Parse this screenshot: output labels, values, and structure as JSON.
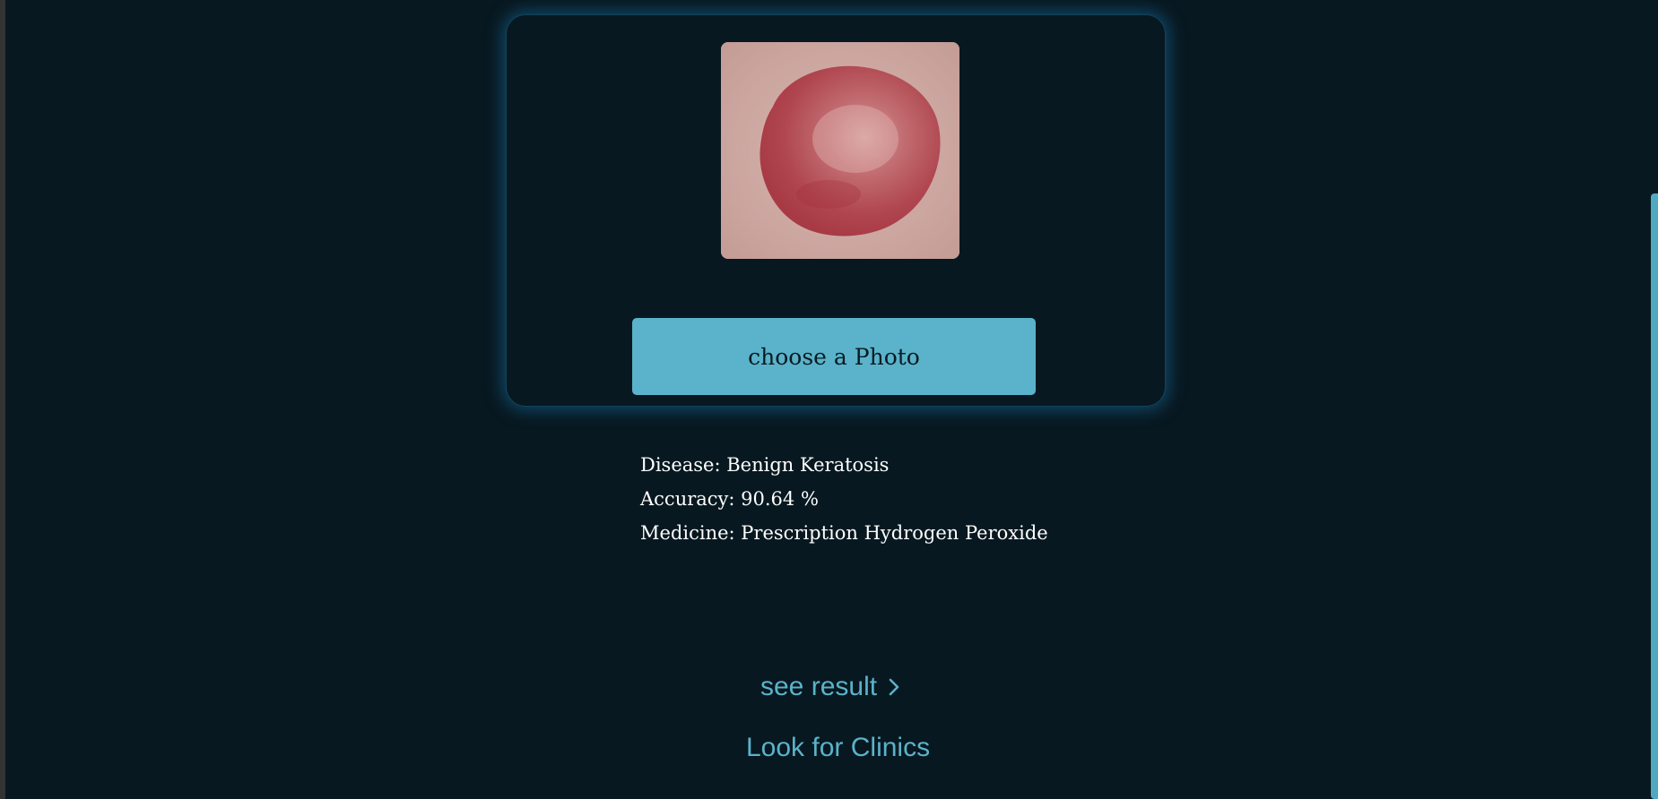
{
  "upload": {
    "button_label": "choose a Photo",
    "preview_alt": "skin lesion photo"
  },
  "result": {
    "disease_label": "Disease: Benign Keratosis",
    "accuracy_label": "Accuracy: 90.64 %",
    "medicine_label": "Medicine: Prescription Hydrogen Peroxide"
  },
  "links": {
    "see_result": "see result",
    "look_for_clinics": "Look for Clinics"
  },
  "colors": {
    "background": "#081820",
    "accent": "#5ab3ca",
    "card_glow": "#166ea0",
    "text": "#ffffff"
  },
  "icons": {
    "see_result_arrow": "chevron-right-icon"
  }
}
